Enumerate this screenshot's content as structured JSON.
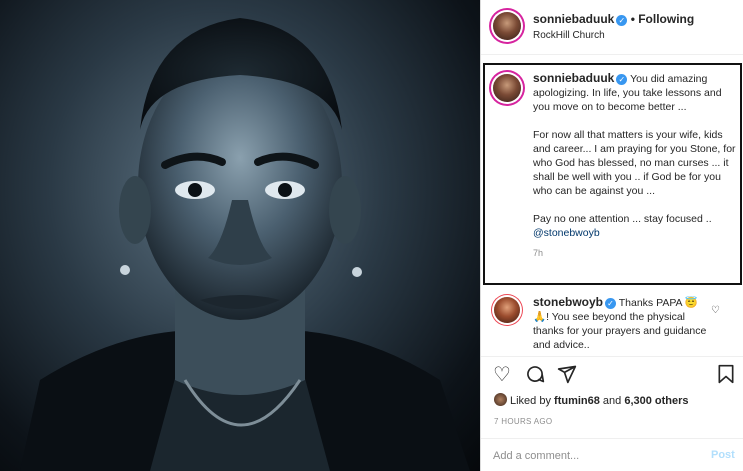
{
  "post": {
    "author": "sonniebaduuk",
    "follow_status": "• Following",
    "location": "RockHill Church"
  },
  "caption": {
    "author": "sonniebaduuk",
    "paragraph1": "You did amazing apologizing. In life, you take lessons and you move on to become better ...",
    "paragraph2": "For now all that matters is your wife, kids and career... I am praying for you Stone, for who God has blessed, no man curses ... it shall be well with you .. if God be for you who can be against you ...",
    "paragraph3": "Pay no one attention ... stay focused ..",
    "mention": "@stonebwoyb",
    "time": "7h"
  },
  "reply": {
    "author": "stonebwoyb",
    "text": "Thanks PAPA 😇 🙏! You see beyond the physical thanks for your prayers and guidance and advice.."
  },
  "likes": {
    "prefix": "Liked by ",
    "user": "ftumin68",
    "middle": " and ",
    "others": "6,300 others"
  },
  "timestamp": "7 HOURS AGO",
  "comment": {
    "placeholder": "Add a comment...",
    "post_label": "Post"
  },
  "icons": {
    "verified": "verified-badge-icon",
    "like": "heart-icon",
    "comment": "comment-icon",
    "share": "share-icon",
    "save": "bookmark-icon"
  },
  "colors": {
    "verified": "#3897f0",
    "link": "#00376b",
    "post_disabled": "#b2dffc",
    "muted": "#8e8e8e"
  }
}
